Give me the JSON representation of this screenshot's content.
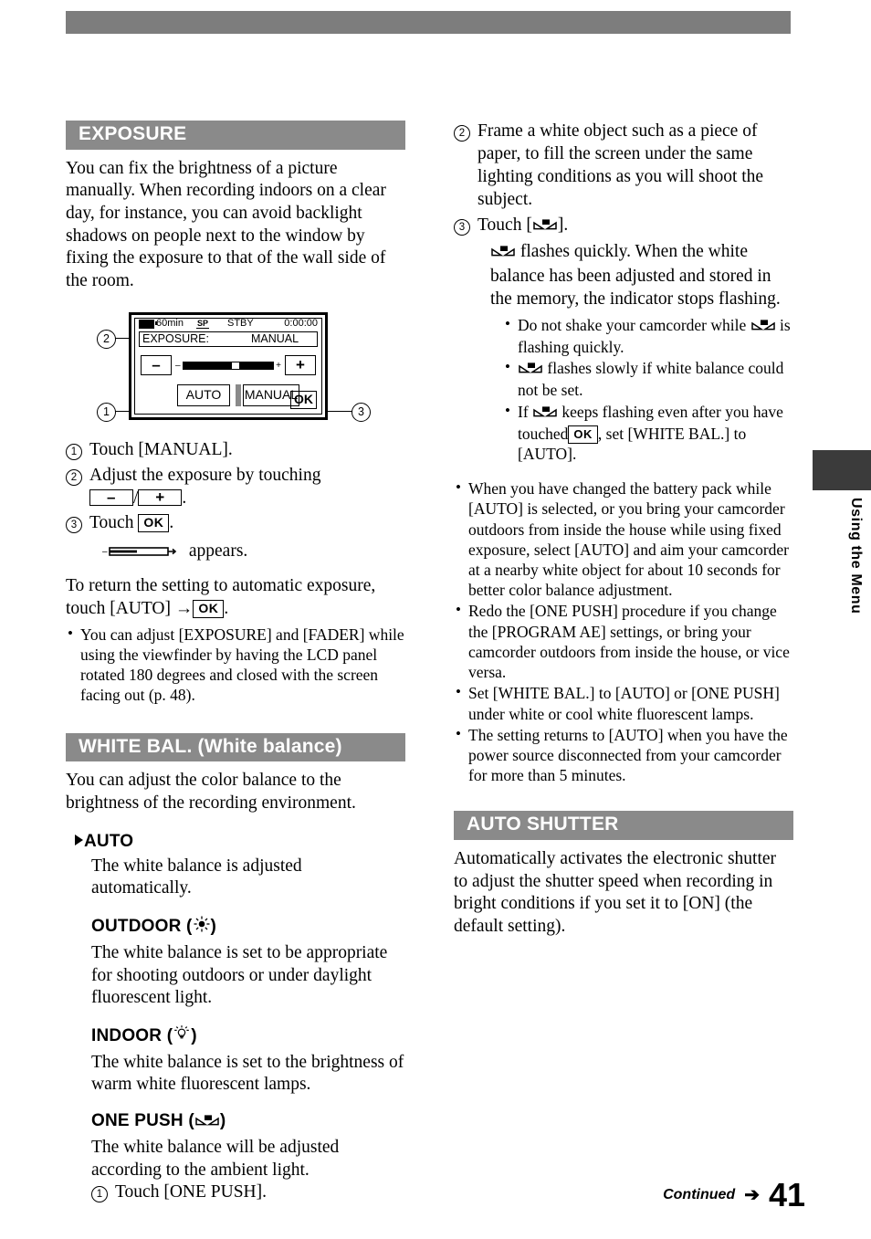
{
  "page": {
    "number": "41",
    "continued_label": "Continued",
    "continued_arrow": "➔",
    "side_tab_label": "Using the Menu"
  },
  "left_column": {
    "exposure": {
      "heading": "EXPOSURE",
      "intro": "You can fix the brightness of a picture manually. When recording indoors on a clear day, for instance, you can avoid backlight shadows on people next to the window by fixing the exposure to that of the wall side of the room.",
      "lcd": {
        "battery_time": "60min",
        "rec_mode": "SP",
        "status": "STBY",
        "timecode": "0:00:00",
        "row_label": "EXPOSURE:",
        "row_value": "MANUAL",
        "minus_label": "–",
        "plus_label": "+",
        "slider_minus": "–",
        "slider_plus": "+",
        "auto_label": "AUTO",
        "manual_label": "MANUAL",
        "ok_label": "OK",
        "callout_1": "1",
        "callout_2": "2",
        "callout_3": "3"
      },
      "steps": [
        {
          "num": "1",
          "text": "Touch [MANUAL]."
        },
        {
          "num": "2",
          "text_before": "Adjust the exposure by touching",
          "btn_minus": "–",
          "sep": "/",
          "btn_plus": "+",
          "text_after": "."
        },
        {
          "num": "3",
          "text_before": "Touch",
          "btn_ok": "OK",
          "text_after": "."
        }
      ],
      "appears_line": "appears.",
      "return_note": "To return the setting to automatic exposure, touch [AUTO] →",
      "return_note_ok": "OK",
      "return_note_end": ".",
      "bullets": [
        "You can adjust [EXPOSURE] and [FADER] while using the viewfinder by having the LCD panel rotated 180 degrees and closed with the screen facing out (p. 48)."
      ]
    },
    "white_bal": {
      "heading": "WHITE BAL. (White balance)",
      "intro": "You can adjust the color balance to the brightness of the recording environment.",
      "options": [
        {
          "name": "AUTO",
          "marker": "▶",
          "icon": "none",
          "desc": "The white balance is adjusted automatically."
        },
        {
          "name": "OUTDOOR",
          "icon": "sun-icon",
          "open_paren": "(",
          "close_paren": ")",
          "desc": "The white balance is set to be appropriate for shooting outdoors or under daylight fluorescent light."
        },
        {
          "name": "INDOOR",
          "icon": "lightbulb-icon",
          "open_paren": "(",
          "close_paren": ")",
          "desc": "The white balance is set to the brightness of warm white fluorescent lamps."
        },
        {
          "name": "ONE PUSH",
          "icon": "one-push-wb-icon",
          "open_paren": "(",
          "close_paren": ")",
          "desc": "The white balance will be adjusted according to the ambient light."
        }
      ],
      "one_push_step1": {
        "num": "1",
        "text": "Touch [ONE PUSH]."
      }
    }
  },
  "right_column": {
    "one_push_steps": [
      {
        "num": "2",
        "text": "Frame a white object such as a piece of paper, to fill the screen under the same lighting conditions as you will shoot the subject."
      },
      {
        "num": "3",
        "text_before": "Touch [",
        "icon": "one-push-wb-icon",
        "text_after": "]."
      }
    ],
    "flash_note_before": "",
    "flash_note": "flashes quickly. When the white balance has been adjusted and stored in the memory, the indicator stops flashing.",
    "sub_bullets": [
      {
        "before": "Do not shake your camcorder while",
        "icon": "one-push-wb-icon",
        "after": "is flashing quickly."
      },
      {
        "before": "",
        "icon": "one-push-wb-icon",
        "after": "flashes slowly if white balance could not be set."
      },
      {
        "before": "If",
        "icon": "one-push-wb-icon",
        "after": "keeps flashing even after you have touched",
        "btn_ok": "OK",
        "tail": ", set [WHITE BAL.] to [AUTO]."
      }
    ],
    "bullets": [
      "When you have changed the battery pack while [AUTO] is selected, or you bring your camcorder outdoors from inside the house while using fixed exposure, select [AUTO] and aim your camcorder at a nearby white object for about 10 seconds for better color balance adjustment.",
      "Redo the [ONE PUSH] procedure if you change the [PROGRAM AE] settings, or bring your camcorder outdoors from inside the house, or vice versa.",
      "Set [WHITE BAL.] to [AUTO] or [ONE PUSH] under white or cool white fluorescent lamps.",
      "The setting returns to [AUTO] when you have the power source disconnected from your camcorder for more than 5 minutes."
    ],
    "auto_shutter": {
      "heading": "AUTO SHUTTER",
      "body": "Automatically activates the electronic shutter to adjust the shutter speed when recording in bright conditions if you set it to [ON] (the default setting)."
    }
  },
  "colors": {
    "section_bar": "#8a8a8a",
    "top_banner": "#7d7d7d",
    "side_tab": "#3b3b3b"
  }
}
